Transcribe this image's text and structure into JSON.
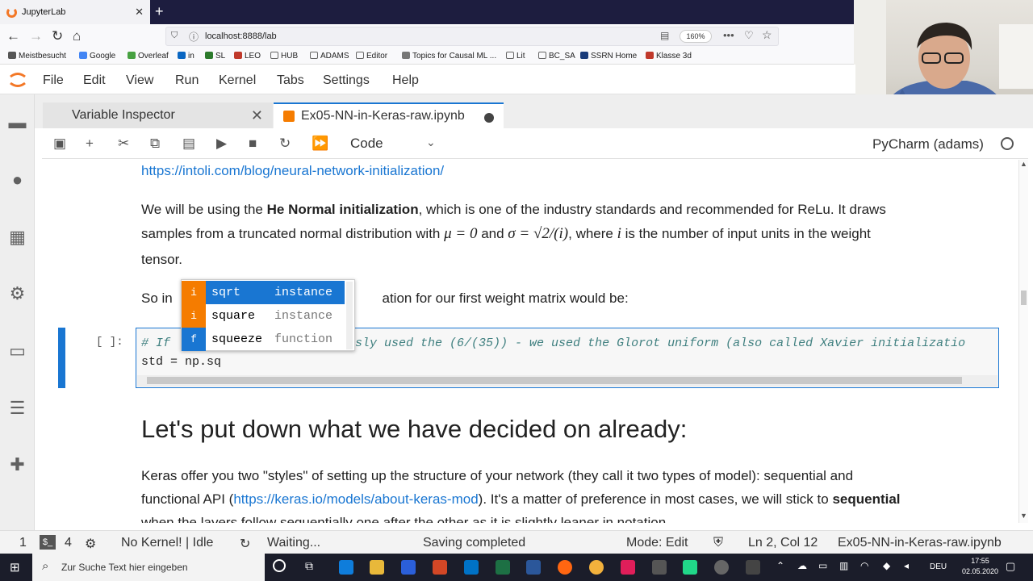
{
  "browser": {
    "tab_title": "JupyterLab",
    "url": "localhost:8888/lab",
    "zoom": "160%",
    "bookmarks": [
      "Meistbesucht",
      "Google",
      "Overleaf",
      "in",
      "SL",
      "LEO",
      "HUB",
      "ADAMS",
      "Editor",
      "Topics for Causal ML ...",
      "Lit",
      "BC_SA",
      "SSRN Home",
      "Klasse 3d"
    ]
  },
  "menu": [
    "File",
    "Edit",
    "View",
    "Run",
    "Kernel",
    "Tabs",
    "Settings",
    "Help"
  ],
  "tabs": {
    "variable_inspector": "Variable Inspector",
    "notebook": "Ex05-NN-in-Keras-raw.ipynb"
  },
  "toolbar": {
    "cell_type": "Code",
    "kernel": "PyCharm (adams)"
  },
  "content": {
    "link": "https://intoli.com/blog/neural-network-initialization/",
    "para1_a": "We will be using the ",
    "para1_bold": "He Normal initialization",
    "para1_b": ", which is one of the industry standards and recommended for ReLu. It draws",
    "para1_line2_a": "samples from a truncated normal distribution with ",
    "para1_line2_b": " and ",
    "para1_line2_c": ", where ",
    "para1_line2_d": " is the number of input units in the weight",
    "para1_line3": "tensor.",
    "math_mu": "μ = 0",
    "math_sigma": "σ = √2/(i)",
    "math_i": "i",
    "para2_a": "So in ",
    "para2_b": "ation for our first weight matrix would be:",
    "prompt": "[ ]:",
    "code_line1_a": "# If ",
    "code_line1_b": "sly used the (6/(35)) - we used the Glorot uniform (also called Xavier initializatio",
    "code_line2": "std = np.sq",
    "heading": "Let's put down what we have decided on already:",
    "para3_line1": "Keras offer you two \"styles\" of setting up the structure of your network (they call it two types of model): sequential and",
    "para3_line2_a": "functional API (",
    "para3_line2_link": "https://keras.io/models/about-keras-mod",
    "para3_line2_b": "). It's a matter of preference in most cases, we will stick to ",
    "para3_line2_bold": "sequential",
    "para3_line3": "when the layers follow sequentially one after the other as it is slightly leaner in notation."
  },
  "completer": [
    {
      "type": "i",
      "label": "sqrt",
      "kind": "instance",
      "color": "#f57c00"
    },
    {
      "type": "i",
      "label": "square",
      "kind": "instance",
      "color": "#f57c00"
    },
    {
      "type": "f",
      "label": "squeeze",
      "kind": "function",
      "color": "#1976d2"
    }
  ],
  "status": {
    "count1": "1",
    "count2": "4",
    "kernel": "No Kernel! | Idle",
    "waiting": "Waiting...",
    "saving": "Saving completed",
    "mode": "Mode: Edit",
    "position": "Ln 2, Col 12",
    "file": "Ex05-NN-in-Keras-raw.ipynb"
  },
  "taskbar": {
    "search_placeholder": "Zur Suche Text hier eingeben",
    "lang": "DEU",
    "time": "17:55",
    "date": "02.05.2020"
  }
}
